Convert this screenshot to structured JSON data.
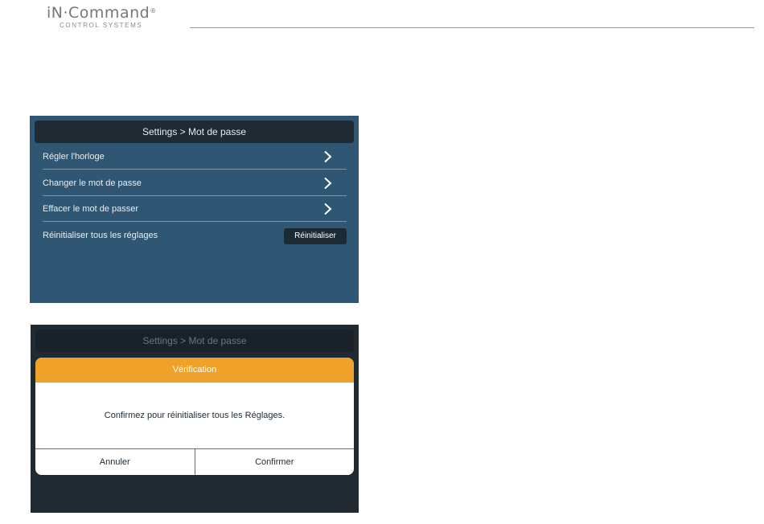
{
  "logo": {
    "main": "iN·Command",
    "reg": "®",
    "sub": "CONTROL SYSTEMS"
  },
  "screen1": {
    "title": "Settings > Mot de passe",
    "items": [
      {
        "label": "Régler l'horloge"
      },
      {
        "label": "Changer le mot de passe"
      },
      {
        "label": "Effacer le mot de passer"
      }
    ],
    "reset_row": {
      "label": "Réinitialiser tous les réglages",
      "button": "Réinitialiser"
    }
  },
  "screen2": {
    "title": "Settings > Mot de passe",
    "dialog": {
      "title": "Vérification",
      "message": "Confirmez pour réinitialiser tous les Réglages.",
      "cancel": "Annuler",
      "confirm": "Confirmer"
    }
  },
  "colors": {
    "screen1_bg": "#2f5774",
    "title_bar": "#1f2a32",
    "dialog_header": "#efa12a"
  },
  "icons": {
    "chevron": "chevron-right-icon"
  }
}
